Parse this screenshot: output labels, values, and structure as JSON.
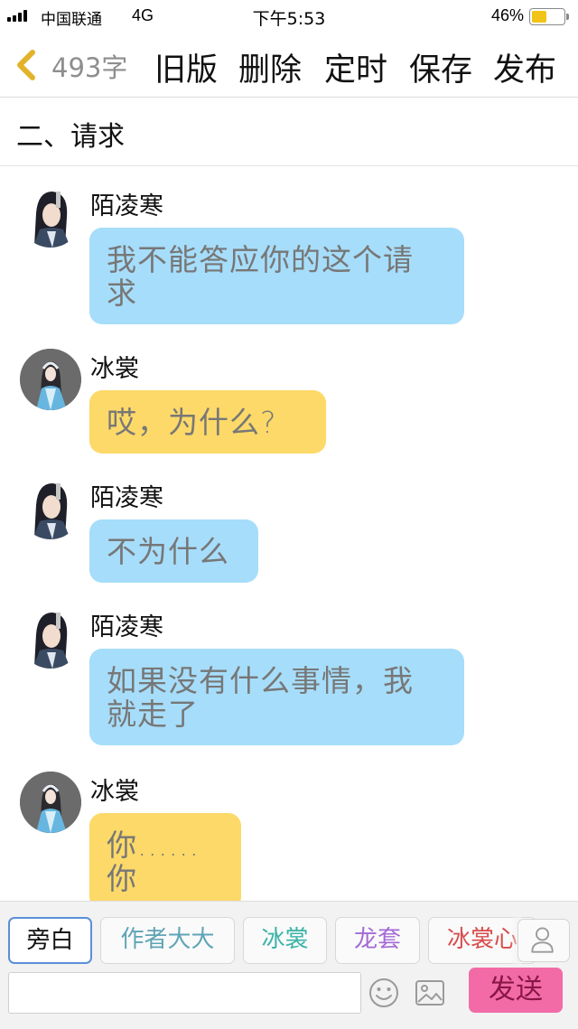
{
  "status_bar": {
    "carrier": "中国联通",
    "network": "4G",
    "time": "下午5:53",
    "battery_percent": "46%",
    "battery_level": 0.46
  },
  "toolbar": {
    "back_icon": "chevron-left-icon",
    "word_count": "493字",
    "buttons": [
      "旧版",
      "删除",
      "定时",
      "保存",
      "发布"
    ]
  },
  "chapter": {
    "title": "二、请求"
  },
  "messages": [
    {
      "speaker": "陌凌寒",
      "text": "我不能答应你的这个请\n求",
      "bubble_color": "#a6ddfa"
    },
    {
      "speaker": "冰裳",
      "text": "哎，为什么?",
      "bubble_color": "#fcd968"
    },
    {
      "speaker": "陌凌寒",
      "text": "不为什么",
      "bubble_color": "#a6ddfa"
    },
    {
      "speaker": "陌凌寒",
      "text": "如果没有什么事情，我\n就走了",
      "bubble_color": "#a6ddfa"
    },
    {
      "speaker": "冰裳",
      "text": "你......你",
      "bubble_color": "#fcd968"
    }
  ],
  "bottom_bar": {
    "roles": [
      {
        "label": "旁白",
        "color": "#111111",
        "selected": true
      },
      {
        "label": "作者大大",
        "color": "#5fa4b6"
      },
      {
        "label": "冰裳",
        "color": "#3bb3a8"
      },
      {
        "label": "龙套",
        "color": "#a36bd6"
      },
      {
        "label": "冰裳心",
        "color": "#d84d4d"
      }
    ],
    "input_placeholder": "",
    "send_label": "发送",
    "icons": [
      "user-icon",
      "emoji-icon",
      "image-icon"
    ],
    "accent_color": "#f26ba7"
  }
}
